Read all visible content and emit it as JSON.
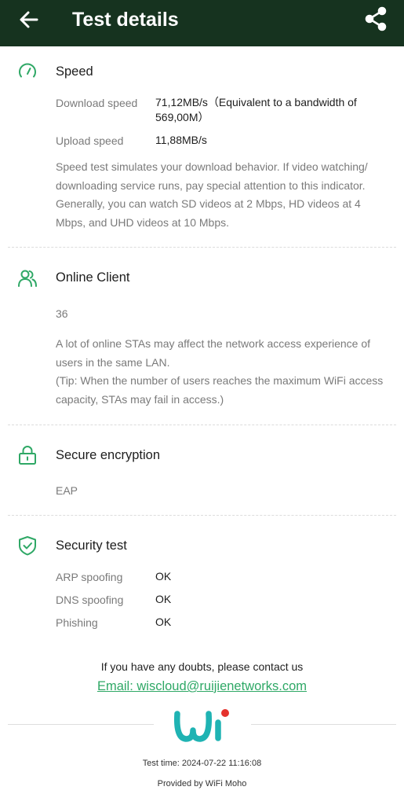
{
  "header": {
    "title": "Test details",
    "back_icon": "arrow-left-icon",
    "share_icon": "share-icon"
  },
  "speed": {
    "icon": "speedometer-icon",
    "title": "Speed",
    "download_label": "Download speed",
    "download_value": "71,12MB/s（Equivalent to a bandwidth of 569,00M）",
    "upload_label": "Upload speed",
    "upload_value": "11,88MB/s",
    "description": "Speed test simulates your download behavior. If video watching/ downloading service runs, pay special attention to this indicator. Generally, you can watch SD videos at 2 Mbps, HD videos at 4 Mbps, and UHD videos at 10 Mbps."
  },
  "online_client": {
    "icon": "users-icon",
    "title": "Online Client",
    "count": "36",
    "description_1": "A lot of online STAs may affect the network access experience of users in the same LAN.",
    "description_2": "(Tip: When the number of users reaches the maximum WiFi access capacity, STAs may fail in access.)"
  },
  "encryption": {
    "icon": "lock-icon",
    "title": "Secure encryption",
    "value": "EAP"
  },
  "security": {
    "icon": "shield-check-icon",
    "title": "Security test",
    "items": [
      {
        "label": "ARP spoofing",
        "value": "OK"
      },
      {
        "label": "DNS spoofing",
        "value": "OK"
      },
      {
        "label": "Phishing",
        "value": "OK"
      }
    ]
  },
  "contact": {
    "text": "If you have any doubts, please contact us",
    "email": "Email: wiscloud@ruijienetworks.com"
  },
  "footer": {
    "logo_icon": "wifi-moho-logo-icon",
    "test_time": "Test time: 2024-07-22 11:16:08",
    "provided_by": "Provided by WiFi Moho"
  },
  "colors": {
    "header_bg": "#16331f",
    "accent_green": "#2fa866",
    "logo_teal": "#1fb3b3",
    "logo_red": "#e5322d"
  }
}
